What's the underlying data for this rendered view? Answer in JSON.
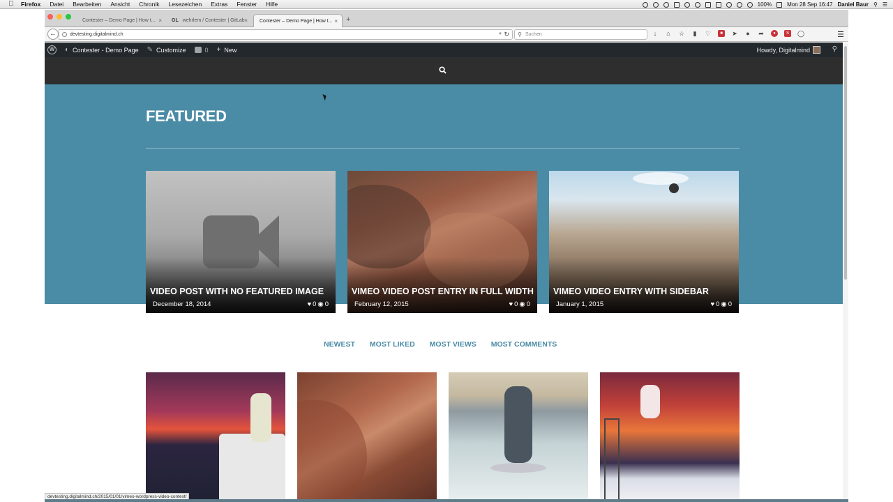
{
  "menubar": {
    "app": "Firefox",
    "items": [
      "Datei",
      "Bearbeiten",
      "Ansicht",
      "Chronik",
      "Lesezeichen",
      "Extras",
      "Fenster",
      "Hilfe"
    ],
    "battery": "100%",
    "clock": "Mon 28 Sep  16:47",
    "user": "Daniel Baur"
  },
  "browser": {
    "tabs": [
      {
        "label": "Contester – Demo Page | How t...",
        "active": false
      },
      {
        "label": "wehrlem / Contester | GitLab",
        "prefix": "GL",
        "active": false
      },
      {
        "label": "Contester – Demo Page | How t...",
        "active": true
      }
    ],
    "url": "devtesting.digitalmind.ch",
    "search_placeholder": "Suchen",
    "status_url": "devtesting.digitalmind.ch/2015/01/01/vimeo-wordpress-video-contest/"
  },
  "adminbar": {
    "site_name": "Contester - Demo Page",
    "customize": "Customize",
    "comments_count": "0",
    "new_label": "New",
    "howdy": "Howdy, Digitalmind"
  },
  "featured": {
    "heading": "FEATURED",
    "cards": [
      {
        "title": "VIDEO POST WITH NO FEATURED IMAGE",
        "date": "December 18, 2014",
        "likes": "0",
        "views": "0"
      },
      {
        "title": "VIMEO VIDEO POST ENTRY IN FULL WIDTH",
        "date": "February 12, 2015",
        "likes": "0",
        "views": "0"
      },
      {
        "title": "VIMEO VIDEO ENTRY WITH SIDEBAR",
        "date": "January 1, 2015",
        "likes": "0",
        "views": "0"
      }
    ]
  },
  "filters": [
    "NEWEST",
    "MOST LIKED",
    "MOST VIEWS",
    "MOST COMMENTS"
  ],
  "colors": {
    "featured_bg": "#4a8ba6",
    "adminbar_bg": "#23282d",
    "header_bg": "#2e2e2e",
    "filter_text": "#4a8ba6"
  }
}
